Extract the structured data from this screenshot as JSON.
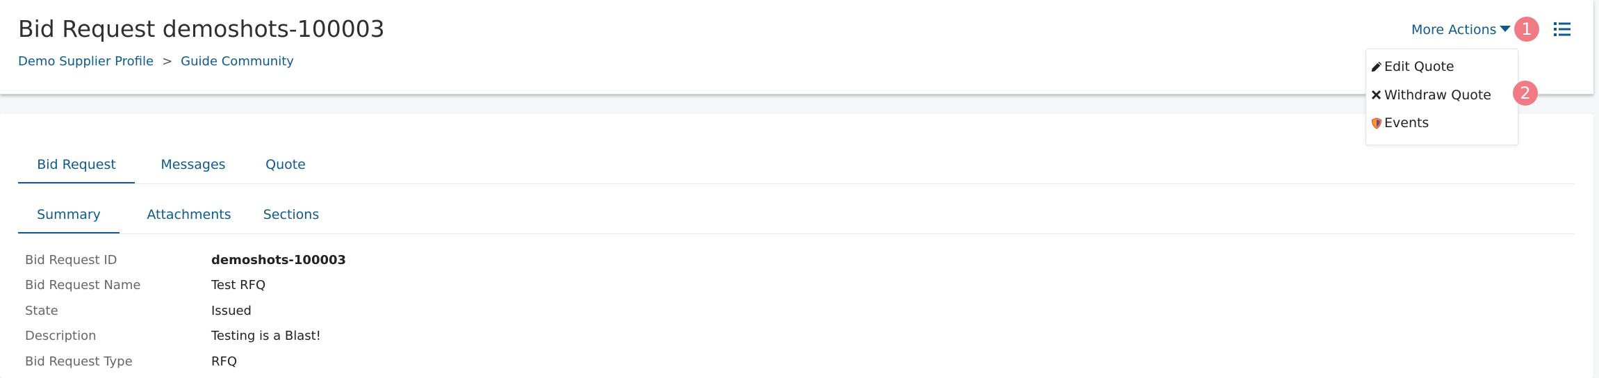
{
  "header": {
    "title": "Bid Request demoshots-100003",
    "breadcrumb": [
      "Demo Supplier Profile",
      "Guide Community"
    ],
    "breadcrumb_separator": ">",
    "more_actions_label": "More Actions",
    "list_icon": "list-icon"
  },
  "annotations": [
    "1",
    "2"
  ],
  "dropdown": {
    "items": [
      {
        "label": "Edit Quote",
        "icon": "pencil-icon"
      },
      {
        "label": "Withdraw Quote",
        "icon": "close-icon"
      },
      {
        "label": "Events",
        "icon": "shield-icon"
      }
    ]
  },
  "tabs": {
    "primary": [
      {
        "label": "Bid Request",
        "active": true
      },
      {
        "label": "Messages",
        "active": false
      },
      {
        "label": "Quote",
        "active": false
      }
    ],
    "secondary": [
      {
        "label": "Summary",
        "active": true
      },
      {
        "label": "Attachments",
        "active": false
      },
      {
        "label": "Sections",
        "active": false
      }
    ]
  },
  "details": [
    {
      "label": "Bid Request ID",
      "value": "demoshots-100003"
    },
    {
      "label": "Bid Request Name",
      "value": "Test RFQ"
    },
    {
      "label": "State",
      "value": "Issued"
    },
    {
      "label": "Description",
      "value": "Testing is a Blast!"
    },
    {
      "label": "Bid Request Type",
      "value": "RFQ"
    }
  ],
  "colors": {
    "link": "#0f5a8c",
    "badge": "#f07a86",
    "title": "#2f2f2f",
    "label": "#666666"
  }
}
